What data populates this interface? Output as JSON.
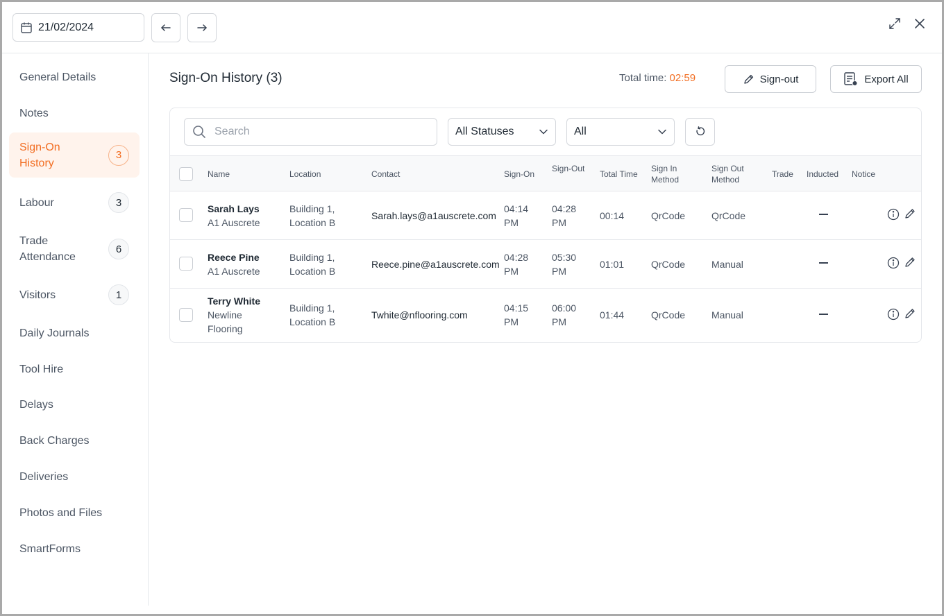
{
  "topbar": {
    "date": "21/02/2024",
    "icons": {
      "calendar": "calendar-icon",
      "prev": "arrow-left-icon",
      "next": "arrow-right-icon",
      "expand": "expand-icon",
      "close": "close-icon"
    }
  },
  "sidebar": {
    "items": [
      {
        "label": "General Details",
        "badge": null
      },
      {
        "label": "Notes",
        "badge": null
      },
      {
        "label": "Sign-On History",
        "badge": "3",
        "active": true
      },
      {
        "label": "Labour",
        "badge": "3"
      },
      {
        "label": "Trade Attendance",
        "badge": "6"
      },
      {
        "label": "Visitors",
        "badge": "1"
      },
      {
        "label": "Daily Journals",
        "badge": null
      },
      {
        "label": "Tool Hire",
        "badge": null
      },
      {
        "label": "Delays",
        "badge": null
      },
      {
        "label": "Back Charges",
        "badge": null
      },
      {
        "label": "Deliveries",
        "badge": null
      },
      {
        "label": "Photos and Files",
        "badge": null
      },
      {
        "label": "SmartForms",
        "badge": null
      }
    ]
  },
  "main": {
    "title": "Sign-On History (3)",
    "total_time_label": "Total time:",
    "total_time_value": "02:59",
    "sign_out_label": "Sign-out",
    "export_label": "Export All",
    "accent_color": "#f26d21"
  },
  "filters": {
    "search_placeholder": "Search",
    "status_value": "All Statuses",
    "type_value": "All"
  },
  "table": {
    "headers": {
      "name": "Name",
      "location": "Location",
      "contact": "Contact",
      "sign_on": "Sign-On",
      "sign_out": "Sign-Out",
      "total_time": "Total Time",
      "sign_in_method_1": "Sign In",
      "sign_in_method_2": "Method",
      "sign_out_method_1": "Sign Out",
      "sign_out_method_2": "Method",
      "trade": "Trade",
      "inducted": "Inducted",
      "notice": "Notice"
    },
    "rows": [
      {
        "name": "Sarah Lays",
        "company_1": "A1 Auscrete",
        "company_2": "",
        "location_1": "Building 1,",
        "location_2": "Location B",
        "contact": "Sarah.lays@a1auscrete.com",
        "sign_on_1": "04:14",
        "sign_on_2": "PM",
        "sign_out_1": "04:28",
        "sign_out_2": "PM",
        "total_time": "00:14",
        "sign_in_method": "QrCode",
        "sign_out_method": "QrCode"
      },
      {
        "name": "Reece Pine",
        "company_1": "A1 Auscrete",
        "company_2": "",
        "location_1": "Building 1,",
        "location_2": "Location B",
        "contact": "Reece.pine@a1auscrete.com",
        "sign_on_1": "04:28",
        "sign_on_2": "PM",
        "sign_out_1": "05:30",
        "sign_out_2": "PM",
        "total_time": "01:01",
        "sign_in_method": "QrCode",
        "sign_out_method": "Manual"
      },
      {
        "name": "Terry White",
        "company_1": "Newline",
        "company_2": "Flooring",
        "location_1": "Building 1,",
        "location_2": "Location B",
        "contact": "Twhite@nflooring.com",
        "sign_on_1": "04:15",
        "sign_on_2": "PM",
        "sign_out_1": "06:00",
        "sign_out_2": "PM",
        "total_time": "01:44",
        "sign_in_method": "QrCode",
        "sign_out_method": "Manual"
      }
    ]
  }
}
